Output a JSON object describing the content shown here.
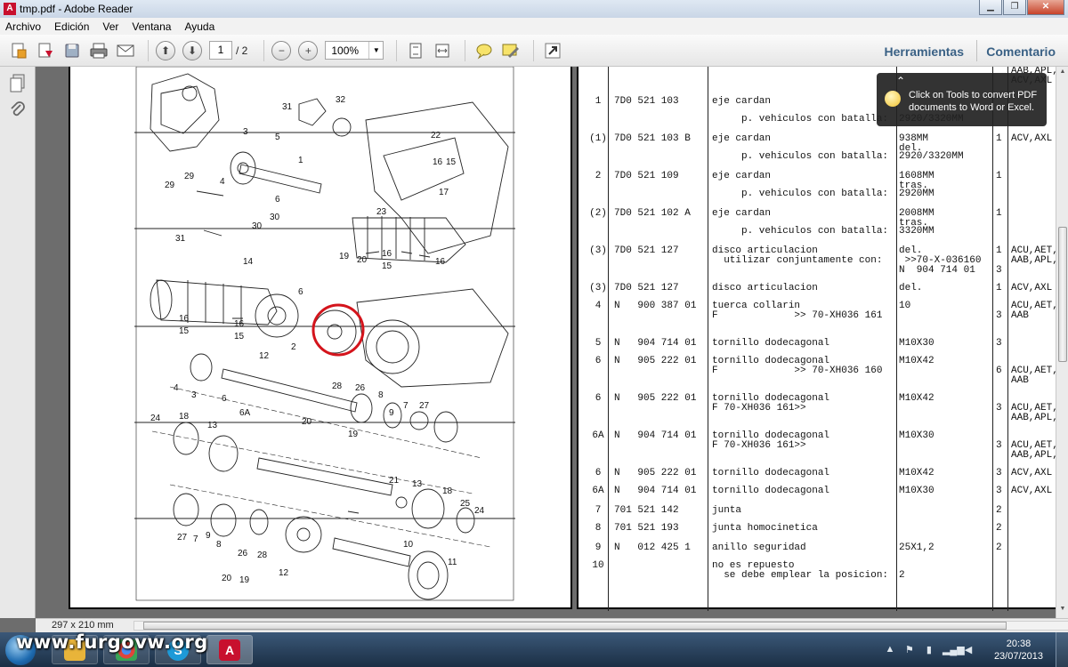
{
  "window": {
    "title": "tmp.pdf - Adobe Reader",
    "app_icon": "A"
  },
  "menu": [
    "Archivo",
    "Edición",
    "Ver",
    "Ventana",
    "Ayuda"
  ],
  "toolbar": {
    "current_page": "1",
    "total_pages": "/ 2",
    "zoom": "100%",
    "tools_label": "Herramientas",
    "comment_label": "Comentario"
  },
  "tooltip": {
    "text": "Click on Tools to convert PDF documents to Word or Excel."
  },
  "status": {
    "page_size": "297 x 210 mm"
  },
  "taskbar": {
    "watermark": "www.furgovw.org",
    "time": "20:38",
    "date": "23/07/2013"
  },
  "parts_header": {
    "top_cut": "AAB,APL,\nACV,AXL"
  },
  "parts": [
    {
      "pos": "1",
      "code": "7D0 521 103",
      "desc": "eje cardan",
      "desc2": "     p. vehiculos con batalla:",
      "spec": "",
      "spec2": "2920/3320MM",
      "qty": "",
      "model": ""
    },
    {
      "pos": "(1)",
      "code": "7D0 521 103 B",
      "desc": "eje cardan",
      "desc2": "     p. vehiculos con batalla:",
      "spec": "938MM\ndel.",
      "spec2": "2920/3320MM",
      "qty": "1",
      "model": "ACV,AXL"
    },
    {
      "pos": "2",
      "code": "7D0 521 109",
      "desc": "eje cardan",
      "desc2": "     p. vehiculos con batalla:",
      "spec": "1608MM\ntras.",
      "spec2": "2920MM",
      "qty": "1",
      "model": ""
    },
    {
      "pos": "(2)",
      "code": "7D0 521 102 A",
      "desc": "eje cardan",
      "desc2": "     p. vehiculos con batalla:",
      "spec": "2008MM\ntras.",
      "spec2": "3320MM",
      "qty": "1",
      "model": ""
    },
    {
      "pos": "(3)",
      "code": "7D0 521 127",
      "desc": "disco articulacion\n  utilizar conjuntamente con:",
      "desc2": "",
      "spec": "del.\n >>70-X-036160\nN  904 714 01",
      "spec2": "",
      "qty": "1\n\n3",
      "model": "ACU,AET,\nAAB,APL,"
    },
    {
      "pos": "(3)",
      "code": "7D0 521 127",
      "desc": "disco articulacion",
      "desc2": "",
      "spec": "del.",
      "spec2": "",
      "qty": "1",
      "model": "ACV,AXL"
    },
    {
      "pos": "4",
      "code": "N   900 387 01",
      "desc": "tuerca collarin\nF             >> 70-XH036 161",
      "desc2": "",
      "spec": "10",
      "spec2": "",
      "qty": "\n3",
      "model": "ACU,AET,\nAAB"
    },
    {
      "pos": "5",
      "code": "N   904 714 01",
      "desc": "tornillo dodecagonal",
      "desc2": "",
      "spec": "M10X30",
      "spec2": "",
      "qty": "3",
      "model": ""
    },
    {
      "pos": "6",
      "code": "N   905 222 01",
      "desc": "tornillo dodecagonal\nF             >> 70-XH036 160",
      "desc2": "",
      "spec": "M10X42",
      "spec2": "",
      "qty": "\n6",
      "model": "\nACU,AET,\nAAB"
    },
    {
      "pos": "6",
      "code": "N   905 222 01",
      "desc": "tornillo dodecagonal\nF 70-XH036 161>>",
      "desc2": "",
      "spec": "M10X42",
      "spec2": "",
      "qty": "\n3",
      "model": "\nACU,AET,\nAAB,APL,"
    },
    {
      "pos": "6A",
      "code": "N   904 714 01",
      "desc": "tornillo dodecagonal\nF 70-XH036 161>>",
      "desc2": "",
      "spec": "M10X30",
      "spec2": "",
      "qty": "\n3",
      "model": "\nACU,AET,\nAAB,APL,"
    },
    {
      "pos": "6",
      "code": "N   905 222 01",
      "desc": "tornillo dodecagonal",
      "desc2": "",
      "spec": "M10X42",
      "spec2": "",
      "qty": "3",
      "model": "ACV,AXL"
    },
    {
      "pos": "6A",
      "code": "N   904 714 01",
      "desc": "tornillo dodecagonal",
      "desc2": "",
      "spec": "M10X30",
      "spec2": "",
      "qty": "3",
      "model": "ACV,AXL"
    },
    {
      "pos": "7",
      "code": "701 521 142",
      "desc": "junta",
      "desc2": "",
      "spec": "",
      "spec2": "",
      "qty": "2",
      "model": ""
    },
    {
      "pos": "8",
      "code": "701 521 193",
      "desc": "junta homocinetica",
      "desc2": "",
      "spec": "",
      "spec2": "",
      "qty": "2",
      "model": ""
    },
    {
      "pos": "9",
      "code": "N   012 425 1",
      "desc": "anillo seguridad",
      "desc2": "",
      "spec": "25X1,2",
      "spec2": "",
      "qty": "2",
      "model": ""
    },
    {
      "pos": "10",
      "code": "",
      "desc": "no es repuesto\n  se debe emplear la posicion:",
      "desc2": "",
      "spec": "\n2",
      "spec2": "",
      "qty": "",
      "model": ""
    }
  ],
  "diagram_labels": [
    "31",
    "32",
    "3",
    "5",
    "1",
    "22",
    "16",
    "15",
    "29",
    "4",
    "6",
    "17",
    "29",
    "30",
    "30",
    "23",
    "31",
    "14",
    "19",
    "20",
    "15",
    "16",
    "16",
    "6",
    "16",
    "15",
    "16",
    "15",
    "12",
    "2",
    "4",
    "3",
    "6",
    "6A",
    "28",
    "26",
    "8",
    "9",
    "7",
    "27",
    "20",
    "19",
    "24",
    "18",
    "13",
    "21",
    "13",
    "18",
    "25",
    "24",
    "27",
    "7",
    "9",
    "8",
    "26",
    "28",
    "12",
    "10",
    "11",
    "20",
    "19"
  ],
  "colors": {
    "highlight_circle": "#d4141c",
    "accent_link": "#3a6185"
  }
}
